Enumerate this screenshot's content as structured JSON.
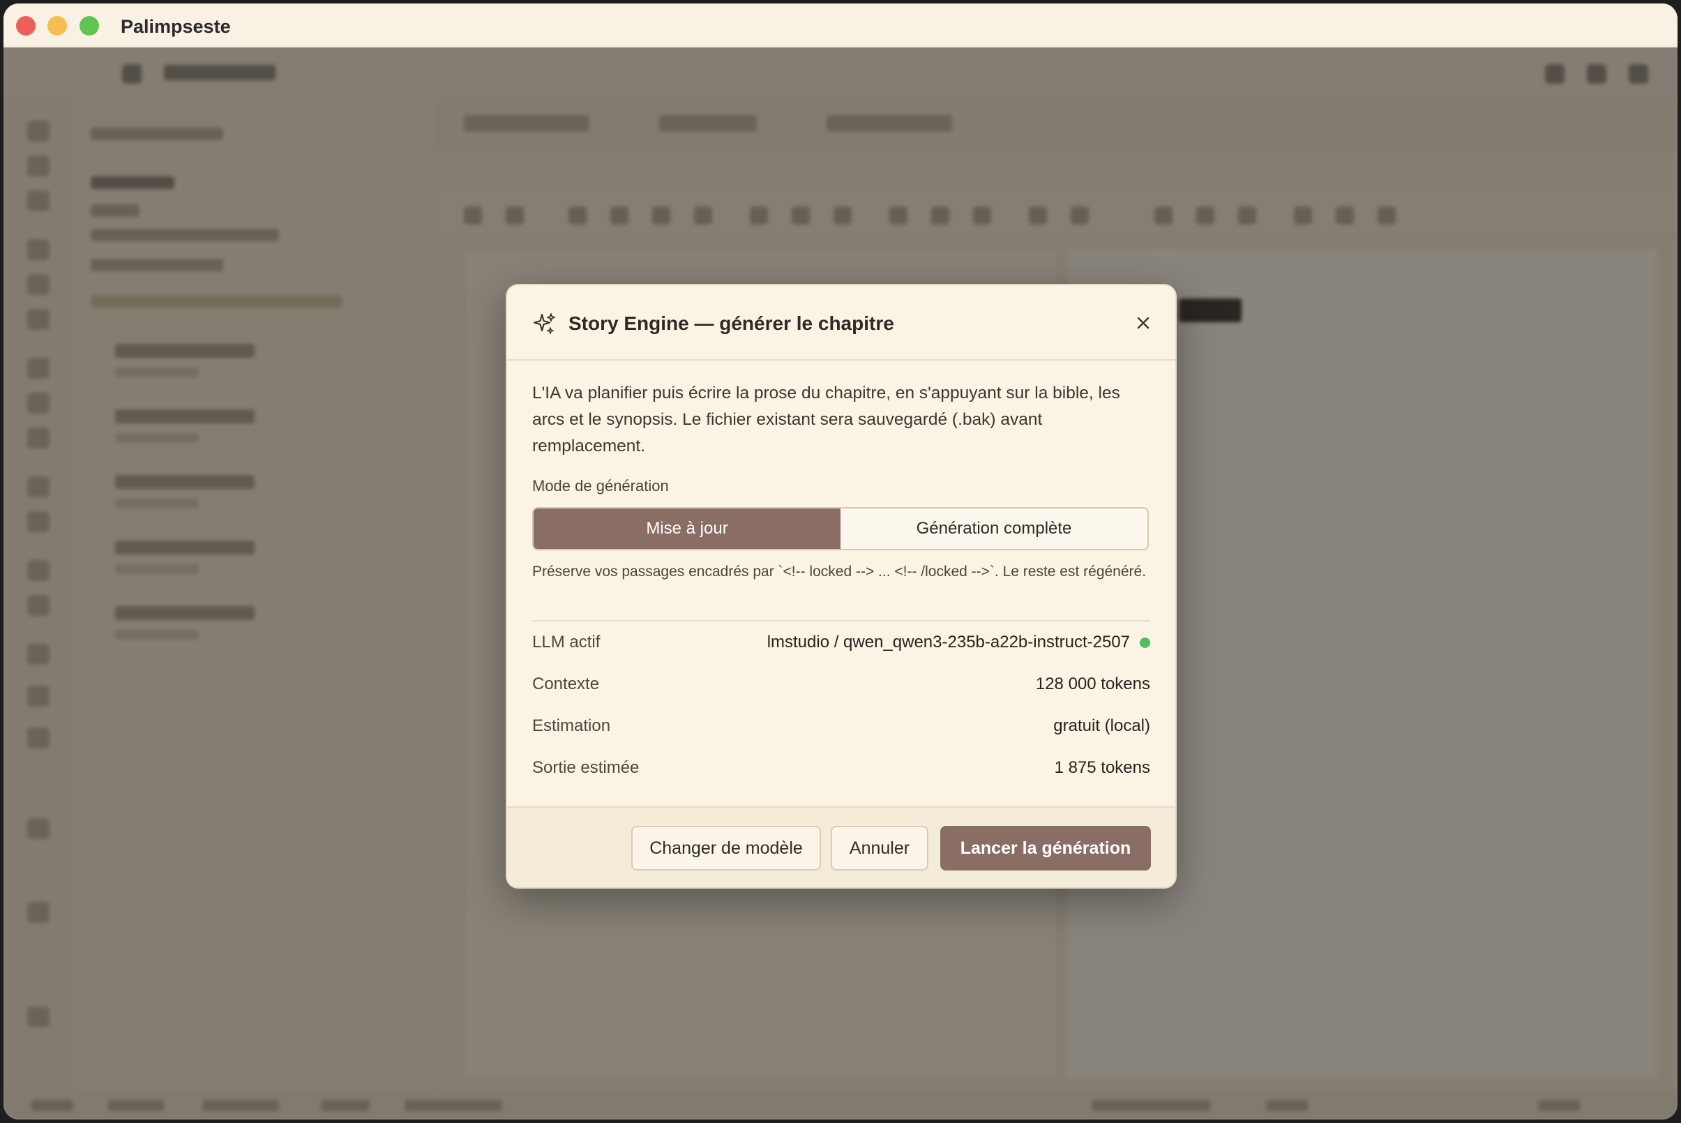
{
  "window": {
    "title": "Palimpseste"
  },
  "modal": {
    "title": "Story Engine — générer le chapitre",
    "description": "L'IA va planifier puis écrire la prose du chapitre, en s'appuyant sur la bible, les arcs et le synopsis. Le fichier existant sera sauvegardé (.bak) avant remplacement.",
    "mode_label": "Mode de génération",
    "modes": [
      {
        "label": "Mise à jour",
        "active": true
      },
      {
        "label": "Génération complète",
        "active": false
      }
    ],
    "mode_help": "Préserve vos passages encadrés par `<!-- locked --> ... <!-- /locked -->`. Le reste est régénéré.",
    "info": [
      {
        "label": "LLM actif",
        "value": "lmstudio / qwen_qwen3-235b-a22b-instruct-2507"
      },
      {
        "label": "Contexte",
        "value": "128 000 tokens"
      },
      {
        "label": "Estimation",
        "value": "gratuit (local)"
      },
      {
        "label": "Sortie estimée",
        "value": "1 875 tokens"
      }
    ],
    "buttons": {
      "change_model": "Changer de modèle",
      "cancel": "Annuler",
      "launch": "Lancer la génération"
    }
  },
  "icons": {
    "sparkle": "sparkle-icon",
    "close": "close-icon"
  },
  "colors": {
    "accent": "#8a6d65",
    "status_ok": "#4fbe5c",
    "modal_bg": "#fbf4e4"
  }
}
